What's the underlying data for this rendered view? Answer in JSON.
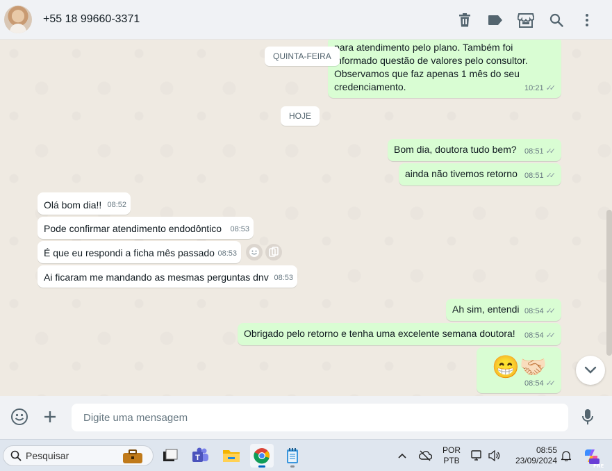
{
  "header": {
    "contact_name": "+55 18 99660-3371",
    "actions": [
      "delete-icon",
      "label-icon",
      "store-icon",
      "search-icon",
      "menu-icon"
    ]
  },
  "chat": {
    "partial_message": {
      "lines": [
        "para atendimento pelo plano. Também foi",
        "informado questão de valores pelo consultor.",
        "Observamos que faz apenas 1 mês do seu",
        "credenciamento."
      ],
      "time": "10:21"
    },
    "date_pills": {
      "thursday": "QUINTA-FEIRA",
      "today": "HOJE"
    },
    "messages": [
      {
        "dir": "out",
        "text": "Bom dia, doutora tudo bem?",
        "time": "08:51"
      },
      {
        "dir": "out",
        "text": "ainda não tivemos retorno",
        "time": "08:51"
      },
      {
        "dir": "in",
        "text": "Olá bom dia!!",
        "time": "08:52"
      },
      {
        "dir": "in",
        "text": "Pode confirmar atendimento endodôntico",
        "time": "08:53"
      },
      {
        "dir": "in",
        "text": "É que eu respondi a ficha mês passado",
        "time": "08:53"
      },
      {
        "dir": "in",
        "text": "Ai ficaram me mandando as mesmas perguntas dnv",
        "time": "08:53"
      },
      {
        "dir": "out",
        "text": "Ah sim, entendi",
        "time": "08:54"
      },
      {
        "dir": "out",
        "text": "Obrigado pelo retorno e tenha uma excelente semana doutora!",
        "time": "08:54"
      },
      {
        "dir": "out",
        "text": "😁🤝🏻",
        "time": "08:54"
      }
    ]
  },
  "composer": {
    "placeholder": "Digite uma mensagem",
    "icons": [
      "emoji-icon",
      "plus-icon",
      "microphone-icon"
    ]
  },
  "taskbar": {
    "search_label": "Pesquisar",
    "apps": [
      "work-bag-icon",
      "desktop-icon",
      "teams-icon",
      "file-explorer-icon",
      "chrome-icon",
      "notepad-icon"
    ],
    "language_line1": "POR",
    "language_line2": "PTB",
    "clock_time": "08:55",
    "clock_date": "23/09/2024",
    "copilot_badge": "PRE"
  }
}
